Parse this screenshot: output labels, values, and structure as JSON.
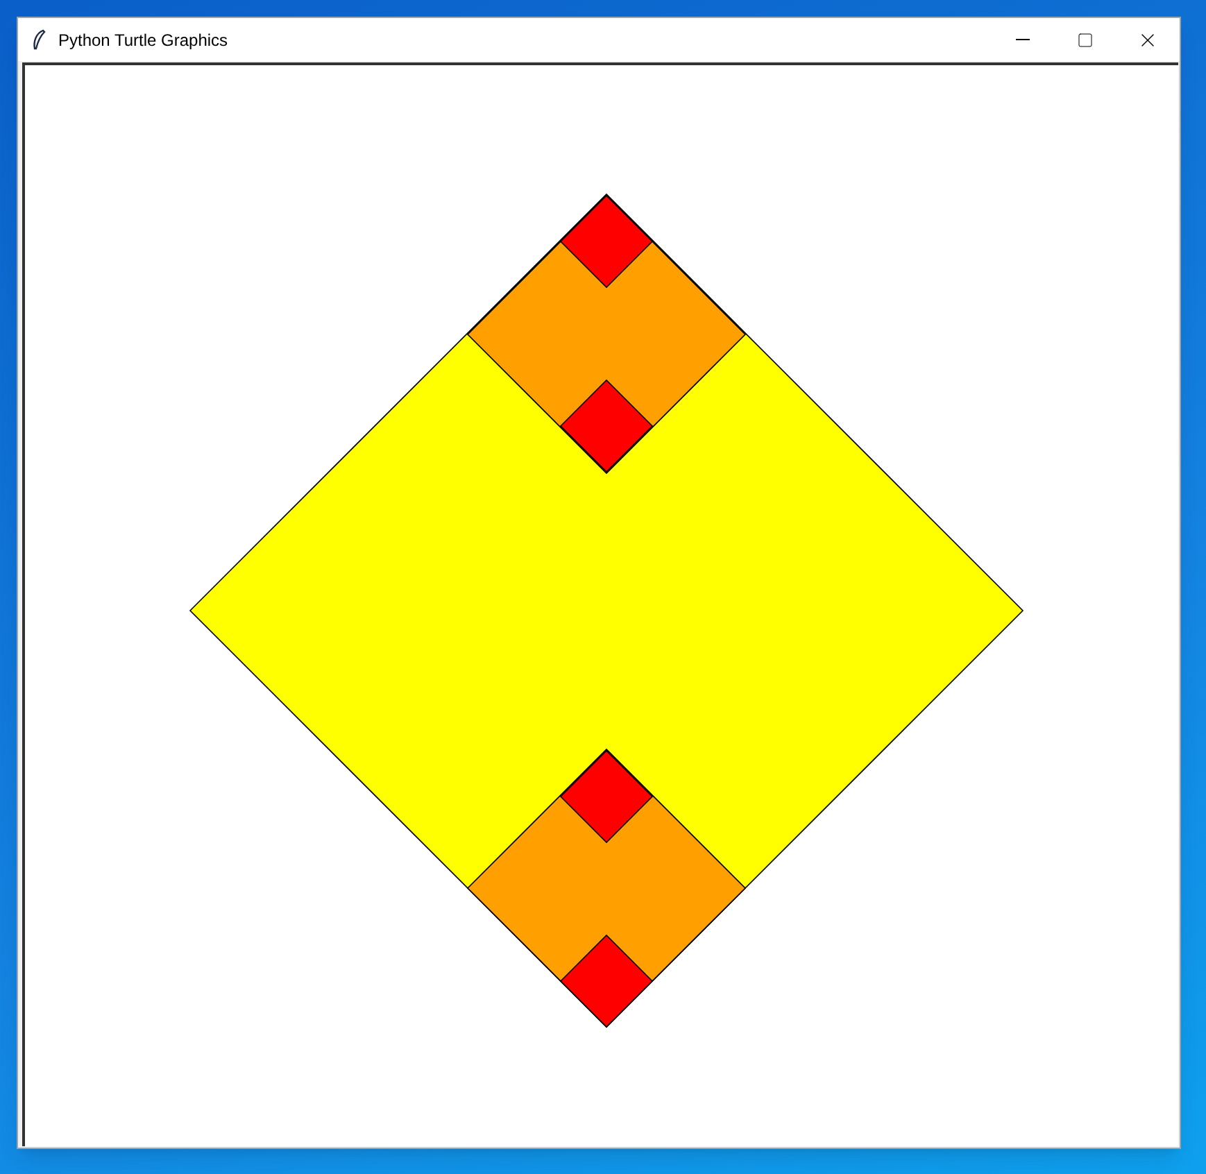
{
  "window": {
    "title": "Python Turtle Graphics"
  }
}
